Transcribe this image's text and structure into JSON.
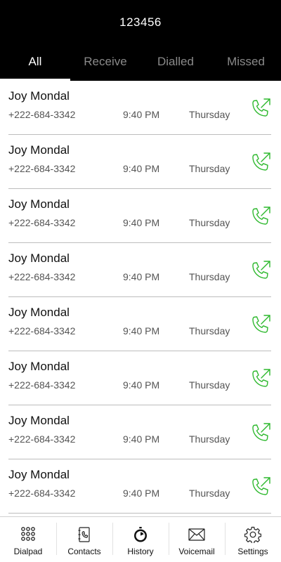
{
  "header": {
    "title": "123456"
  },
  "tabs": [
    {
      "label": "All",
      "active": true
    },
    {
      "label": "Receive",
      "active": false
    },
    {
      "label": "Dialled",
      "active": false
    },
    {
      "label": "Missed",
      "active": false
    }
  ],
  "calls": [
    {
      "name": "Joy Mondal",
      "number": "+222-684-3342",
      "time": "9:40 PM",
      "day": "Thursday",
      "icon": "outgoing-call-icon"
    },
    {
      "name": "Joy Mondal",
      "number": "+222-684-3342",
      "time": "9:40 PM",
      "day": "Thursday",
      "icon": "outgoing-call-icon"
    },
    {
      "name": "Joy Mondal",
      "number": "+222-684-3342",
      "time": "9:40 PM",
      "day": "Thursday",
      "icon": "outgoing-call-icon"
    },
    {
      "name": "Joy Mondal",
      "number": "+222-684-3342",
      "time": "9:40 PM",
      "day": "Thursday",
      "icon": "outgoing-call-icon"
    },
    {
      "name": "Joy Mondal",
      "number": "+222-684-3342",
      "time": "9:40 PM",
      "day": "Thursday",
      "icon": "outgoing-call-icon"
    },
    {
      "name": "Joy Mondal",
      "number": "+222-684-3342",
      "time": "9:40 PM",
      "day": "Thursday",
      "icon": "outgoing-call-icon"
    },
    {
      "name": "Joy Mondal",
      "number": "+222-684-3342",
      "time": "9:40 PM",
      "day": "Thursday",
      "icon": "outgoing-call-icon"
    },
    {
      "name": "Joy Mondal",
      "number": "+222-684-3342",
      "time": "9:40 PM",
      "day": "Thursday",
      "icon": "outgoing-call-icon"
    }
  ],
  "bottom_nav": [
    {
      "label": "Dialpad",
      "icon": "dialpad-icon",
      "active": false
    },
    {
      "label": "Contacts",
      "icon": "contacts-icon",
      "active": false
    },
    {
      "label": "History",
      "icon": "history-icon",
      "active": true
    },
    {
      "label": "Voicemail",
      "icon": "voicemail-icon",
      "active": false
    },
    {
      "label": "Settings",
      "icon": "settings-icon",
      "active": false
    }
  ],
  "colors": {
    "header_bg": "#000000",
    "active_tab": "#ffffff",
    "inactive_tab": "#8a8a8a",
    "call_icon": "#2db82d",
    "divider": "#bdbdbd"
  }
}
